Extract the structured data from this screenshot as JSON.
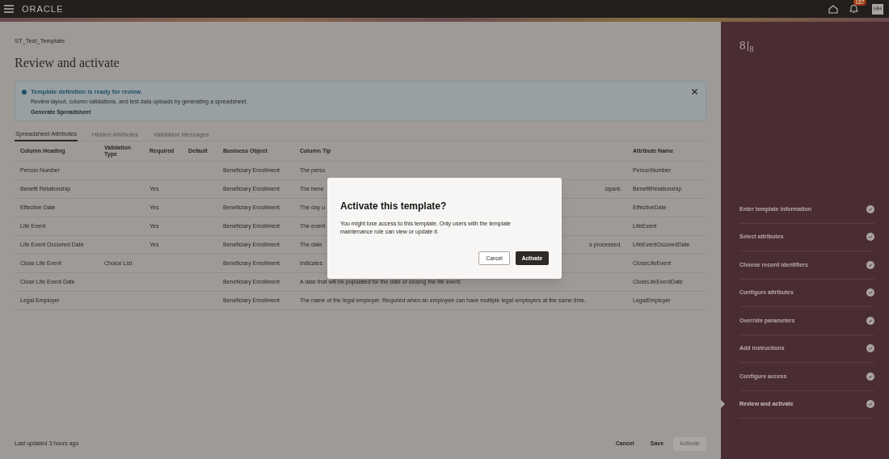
{
  "header": {
    "brand": "ORACLE",
    "notification_count": "187",
    "avatar": "HH"
  },
  "page": {
    "breadcrumb": "ST_Test_Template",
    "title": "Review and activate"
  },
  "alert": {
    "title": "Template definition is ready for review.",
    "message": "Review layout, column validations, and test data uploads by generating a spreadsheet.",
    "link": "Generate Spreadsheet"
  },
  "tabs": [
    {
      "label": "Spreadsheet Attributes",
      "selected": true
    },
    {
      "label": "Hidden Attributes",
      "selected": false
    },
    {
      "label": "Validation Messages",
      "selected": false
    }
  ],
  "table": {
    "columns": [
      "Column Heading",
      "Validation Type",
      "Required",
      "Default",
      "Business Object",
      "Column Tip",
      "Attribute Name"
    ],
    "rows": [
      {
        "heading": "Person Number",
        "validation": "",
        "required": "",
        "default": "",
        "object": "Beneficiary Enrollment",
        "tip": "The perso",
        "tip_end": "",
        "attribute": "PersonNumber"
      },
      {
        "heading": "Benefit Relationship",
        "validation": "",
        "required": "Yes",
        "default": "",
        "object": "Beneficiary Enrollment",
        "tip": "The bene",
        "tip_end": "cipant.",
        "attribute": "BenefitRelationship"
      },
      {
        "heading": "Effective Date",
        "validation": "",
        "required": "Yes",
        "default": "",
        "object": "Beneficiary Enrollment",
        "tip": "The day u",
        "tip_end": "",
        "attribute": "EffectiveDate"
      },
      {
        "heading": "Life Event",
        "validation": "",
        "required": "Yes",
        "default": "",
        "object": "Beneficiary Enrollment",
        "tip": "The event",
        "tip_end": "",
        "attribute": "LifeEvent"
      },
      {
        "heading": "Life Event Occurred Date",
        "validation": "",
        "required": "Yes",
        "default": "",
        "object": "Beneficiary Enrollment",
        "tip": "The date",
        "tip_end": "s processed.",
        "attribute": "LifeEventOccuredDate"
      },
      {
        "heading": "Close Life Event",
        "validation": "Choice List",
        "required": "",
        "default": "",
        "object": "Beneficiary Enrollment",
        "tip": "Indicates",
        "tip_end": "",
        "attribute": "CloseLifeEvent"
      },
      {
        "heading": "Close Life Event Date",
        "validation": "",
        "required": "",
        "default": "",
        "object": "Beneficiary Enrollment",
        "tip": "A date that will be populated for the date of closing the life event.",
        "tip_end": "",
        "attribute": "CloseLifeEventDate"
      },
      {
        "heading": "Legal Employer",
        "validation": "",
        "required": "",
        "default": "",
        "object": "Beneficiary Enrollment",
        "tip": "The name of the legal employer. Required when an employee can have multiple legal employers at the same time.",
        "tip_end": "",
        "attribute": "LegalEmployer"
      }
    ]
  },
  "footer": {
    "status": "Last updated 3 hours ago",
    "buttons": [
      {
        "label": "Cancel",
        "disabled": false
      },
      {
        "label": "Save",
        "disabled": false
      },
      {
        "label": "Activate",
        "disabled": true
      }
    ]
  },
  "progress": {
    "current": "8",
    "total": "8"
  },
  "steps": [
    {
      "label": "Enter template information",
      "done": true,
      "selected": false
    },
    {
      "label": "Select attributes",
      "done": true,
      "selected": false
    },
    {
      "label": "Choose record identifiers",
      "done": true,
      "selected": false
    },
    {
      "label": "Configure attributes",
      "done": true,
      "selected": false
    },
    {
      "label": "Override parameters",
      "done": true,
      "selected": false
    },
    {
      "label": "Add instructions",
      "done": true,
      "selected": false
    },
    {
      "label": "Configure access",
      "done": true,
      "selected": false
    },
    {
      "label": "Review and activate",
      "done": true,
      "selected": true
    }
  ],
  "dialog": {
    "title": "Activate this template?",
    "message": "You might lose access to this template. Only users with the template maintenance role can view or update it.",
    "buttons": [
      {
        "label": "Cancel",
        "kind": "secondary"
      },
      {
        "label": "Activate",
        "kind": "primary"
      }
    ]
  }
}
